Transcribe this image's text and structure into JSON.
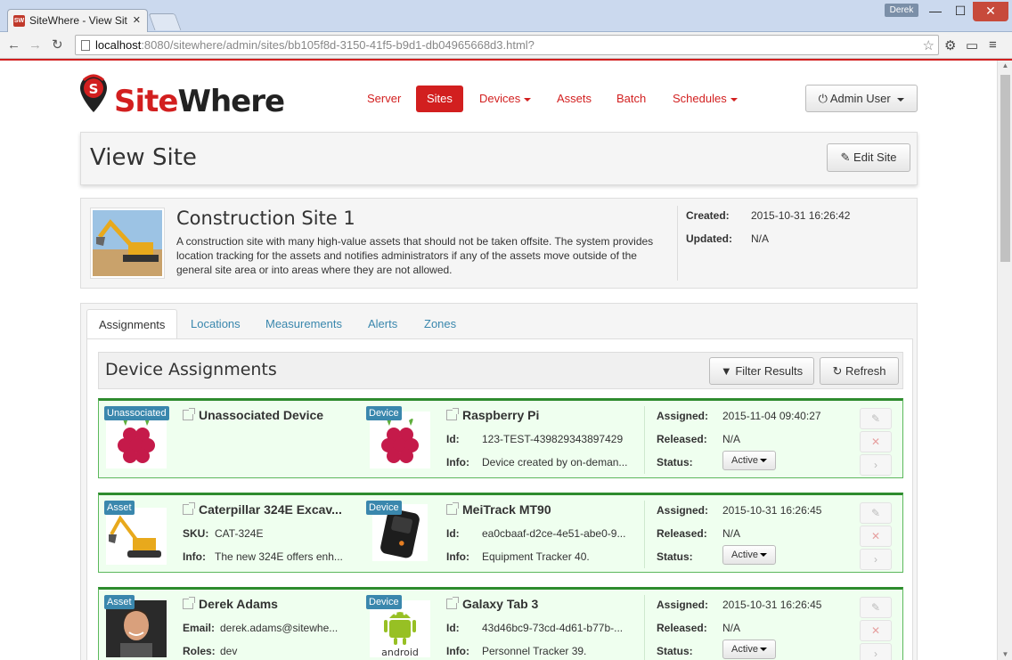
{
  "browser": {
    "tab_title": "SiteWhere - View Sit",
    "favicon_text": "SW",
    "user_badge": "Derek",
    "url_host": "localhost",
    "url_rest": ":8080/sitewhere/admin/sites/bb105f8d-3150-41f5-b9d1-db04965668d3.html?"
  },
  "logo": {
    "part1": "Site",
    "part2": "Where",
    "color": "#d21f1f"
  },
  "nav": {
    "items": [
      {
        "label": "Server"
      },
      {
        "label": "Sites"
      },
      {
        "label": "Devices"
      },
      {
        "label": "Assets"
      },
      {
        "label": "Batch"
      },
      {
        "label": "Schedules"
      }
    ],
    "active": "Sites",
    "user_menu": "Admin User"
  },
  "page": {
    "title": "View Site",
    "edit_label": "Edit Site"
  },
  "site": {
    "name": "Construction Site 1",
    "description": "A construction site with many high-value assets that should not be taken offsite. The system provides location tracking for the assets and notifies administrators if any of the assets move outside of the general site area or into areas where they are not allowed.",
    "created_label": "Created:",
    "created": "2015-10-31 16:26:42",
    "updated_label": "Updated:",
    "updated": "N/A"
  },
  "tabs": [
    "Assignments",
    "Locations",
    "Measurements",
    "Alerts",
    "Zones"
  ],
  "assignments": {
    "heading": "Device Assignments",
    "filter_label": "Filter Results",
    "refresh_label": "Refresh",
    "rows": [
      {
        "badge": "Unassociated",
        "title": "Unassociated Device",
        "f1_label": "",
        "f1_value": "",
        "f2_label": "",
        "f2_value": "",
        "device_badge": "Device",
        "device": "Raspberry Pi",
        "id_label": "Id:",
        "id": "123-TEST-439829343897429",
        "info_label": "Info:",
        "info": "Device created by on-deman...",
        "assigned_label": "Assigned:",
        "assigned": "2015-11-04 09:40:27",
        "released_label": "Released:",
        "released": "N/A",
        "status_label": "Status:",
        "status": "Active"
      },
      {
        "badge": "Asset",
        "title": "Caterpillar 324E Excav...",
        "f1_label": "SKU:",
        "f1_value": "CAT-324E",
        "f2_label": "Info:",
        "f2_value": "The new 324E offers enh...",
        "device_badge": "Device",
        "device": "MeiTrack MT90",
        "id_label": "Id:",
        "id": "ea0cbaaf-d2ce-4e51-abe0-9...",
        "info_label": "Info:",
        "info": "Equipment Tracker 40.",
        "assigned_label": "Assigned:",
        "assigned": "2015-10-31 16:26:45",
        "released_label": "Released:",
        "released": "N/A",
        "status_label": "Status:",
        "status": "Active"
      },
      {
        "badge": "Asset",
        "title": "Derek Adams",
        "f1_label": "Email:",
        "f1_value": "derek.adams@sitewhe...",
        "f2_label": "Roles:",
        "f2_value": "dev",
        "device_badge": "Device",
        "device": "Galaxy Tab 3",
        "id_label": "Id:",
        "id": "43d46bc9-73cd-4d61-b77b-...",
        "info_label": "Info:",
        "info": "Personnel Tracker 39.",
        "assigned_label": "Assigned:",
        "assigned": "2015-10-31 16:26:45",
        "released_label": "Released:",
        "released": "N/A",
        "status_label": "Status:",
        "status": "Active"
      }
    ]
  },
  "android_text": "android",
  "colors": {
    "brand": "#d21f1f",
    "link": "#3a87ad",
    "row_border": "#2e8b2e",
    "row_bg": "#efffef"
  }
}
